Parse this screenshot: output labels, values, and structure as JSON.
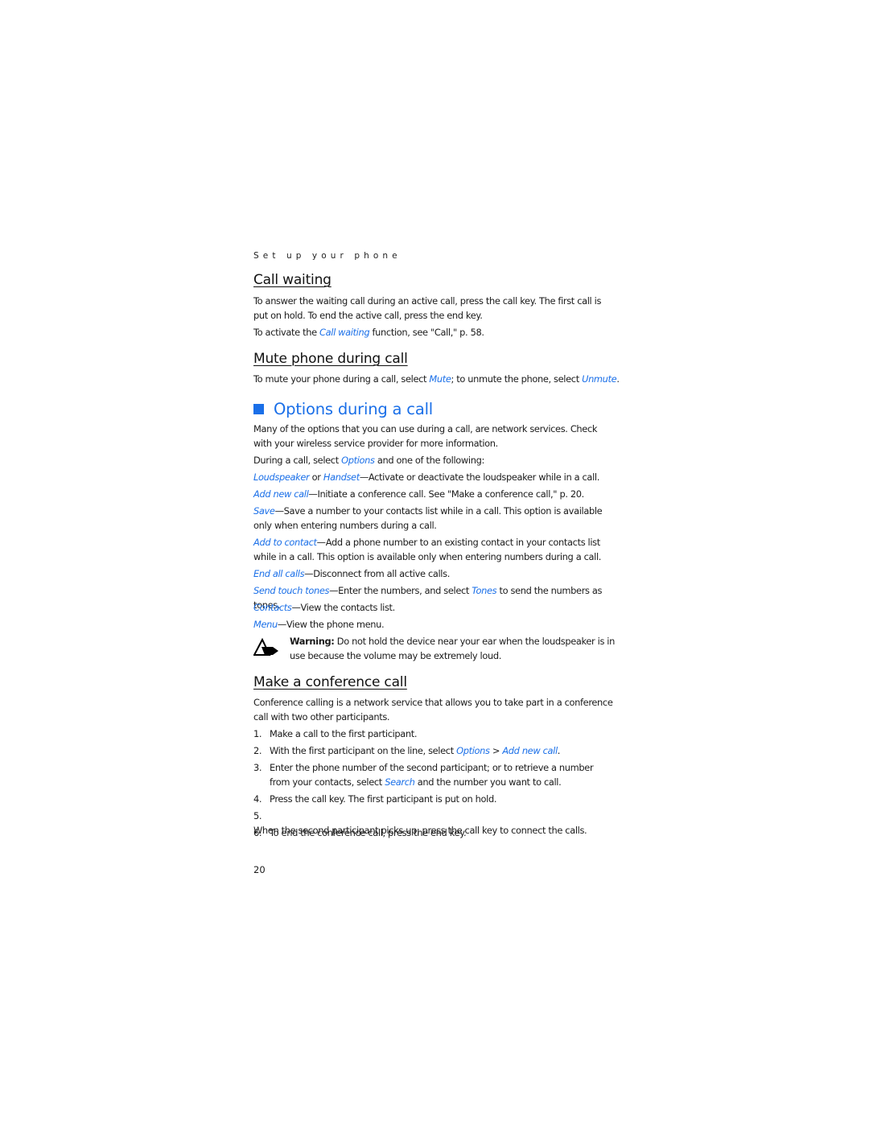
{
  "running_head": "Set up your phone",
  "sections": {
    "call_waiting": {
      "title": "Call waiting",
      "para1": "To answer the waiting call during an active call, press the call key. The first call is put on hold. To end the active call, press the end key.",
      "para2_pre": "To activate the ",
      "para2_link": "Call waiting",
      "para2_post": " function, see \"Call,\" p. 58."
    },
    "mute": {
      "title": "Mute phone during call",
      "pre": "To mute your phone during a call, select ",
      "link1": "Mute",
      "mid": "; to unmute the phone, select ",
      "link2": "Unmute",
      "post": "."
    },
    "options": {
      "title": "Options during a call",
      "intro": "Many of the options that you can use during a call, are network services. Check with your wireless service provider for more information.",
      "select_pre": "During a call, select ",
      "select_link": "Options",
      "select_post": " and one of the following:",
      "items": [
        {
          "link": "Loudspeaker",
          "mid": " or ",
          "link2": "Handset",
          "text": "—Activate or deactivate the loudspeaker while in a call."
        },
        {
          "link": "Add new call",
          "text": "—Initiate a conference call. See \"Make a conference call,\" p. 20."
        },
        {
          "link": "Save",
          "text": "—Save a number to your contacts list while in a call. This option is available only when entering numbers during a call."
        },
        {
          "link": "Add to contact",
          "text": "—Add a phone number to an existing contact in your contacts list while in a call. This option is available only when entering numbers during a call."
        },
        {
          "link": "End all calls",
          "text": "—Disconnect from all active calls."
        },
        {
          "link": "Send touch tones",
          "text": "—Enter the numbers, and select ",
          "link2": "Tones",
          "text2": " to send the numbers as tones."
        },
        {
          "link": "Contacts",
          "text": "—View the contacts list."
        },
        {
          "link": "Menu",
          "text": "—View the phone menu."
        }
      ],
      "warning_label": "Warning:",
      "warning_text": " Do not hold the device near your ear when the loudspeaker is in use because the volume may be extremely loud."
    },
    "conference": {
      "title": "Make a conference call",
      "intro": "Conference calling is a network service that allows you to take part in a conference call with two other participants.",
      "steps": [
        {
          "num": "1.",
          "text": "Make a call to the first participant."
        },
        {
          "num": "2.",
          "pre": "With the first participant on the line, select ",
          "link": "Options",
          "mid": " > ",
          "link2": "Add new call",
          "post": "."
        },
        {
          "num": "3.",
          "pre": "Enter the phone number of the second participant; or to retrieve a number from your contacts, select ",
          "link": "Search",
          "post": " and the number you want to call."
        },
        {
          "num": "4.",
          "text": "Press the call key. The first participant is put on hold."
        },
        {
          "num": "5.",
          "text": "When the second participant picks up, press the call key to connect the calls."
        },
        {
          "num": "6.",
          "text": "To end the conference call, press the end key."
        }
      ]
    }
  },
  "page_number": "20",
  "colors": {
    "accent": "#1a6fe8",
    "text": "#1a1a1a"
  }
}
